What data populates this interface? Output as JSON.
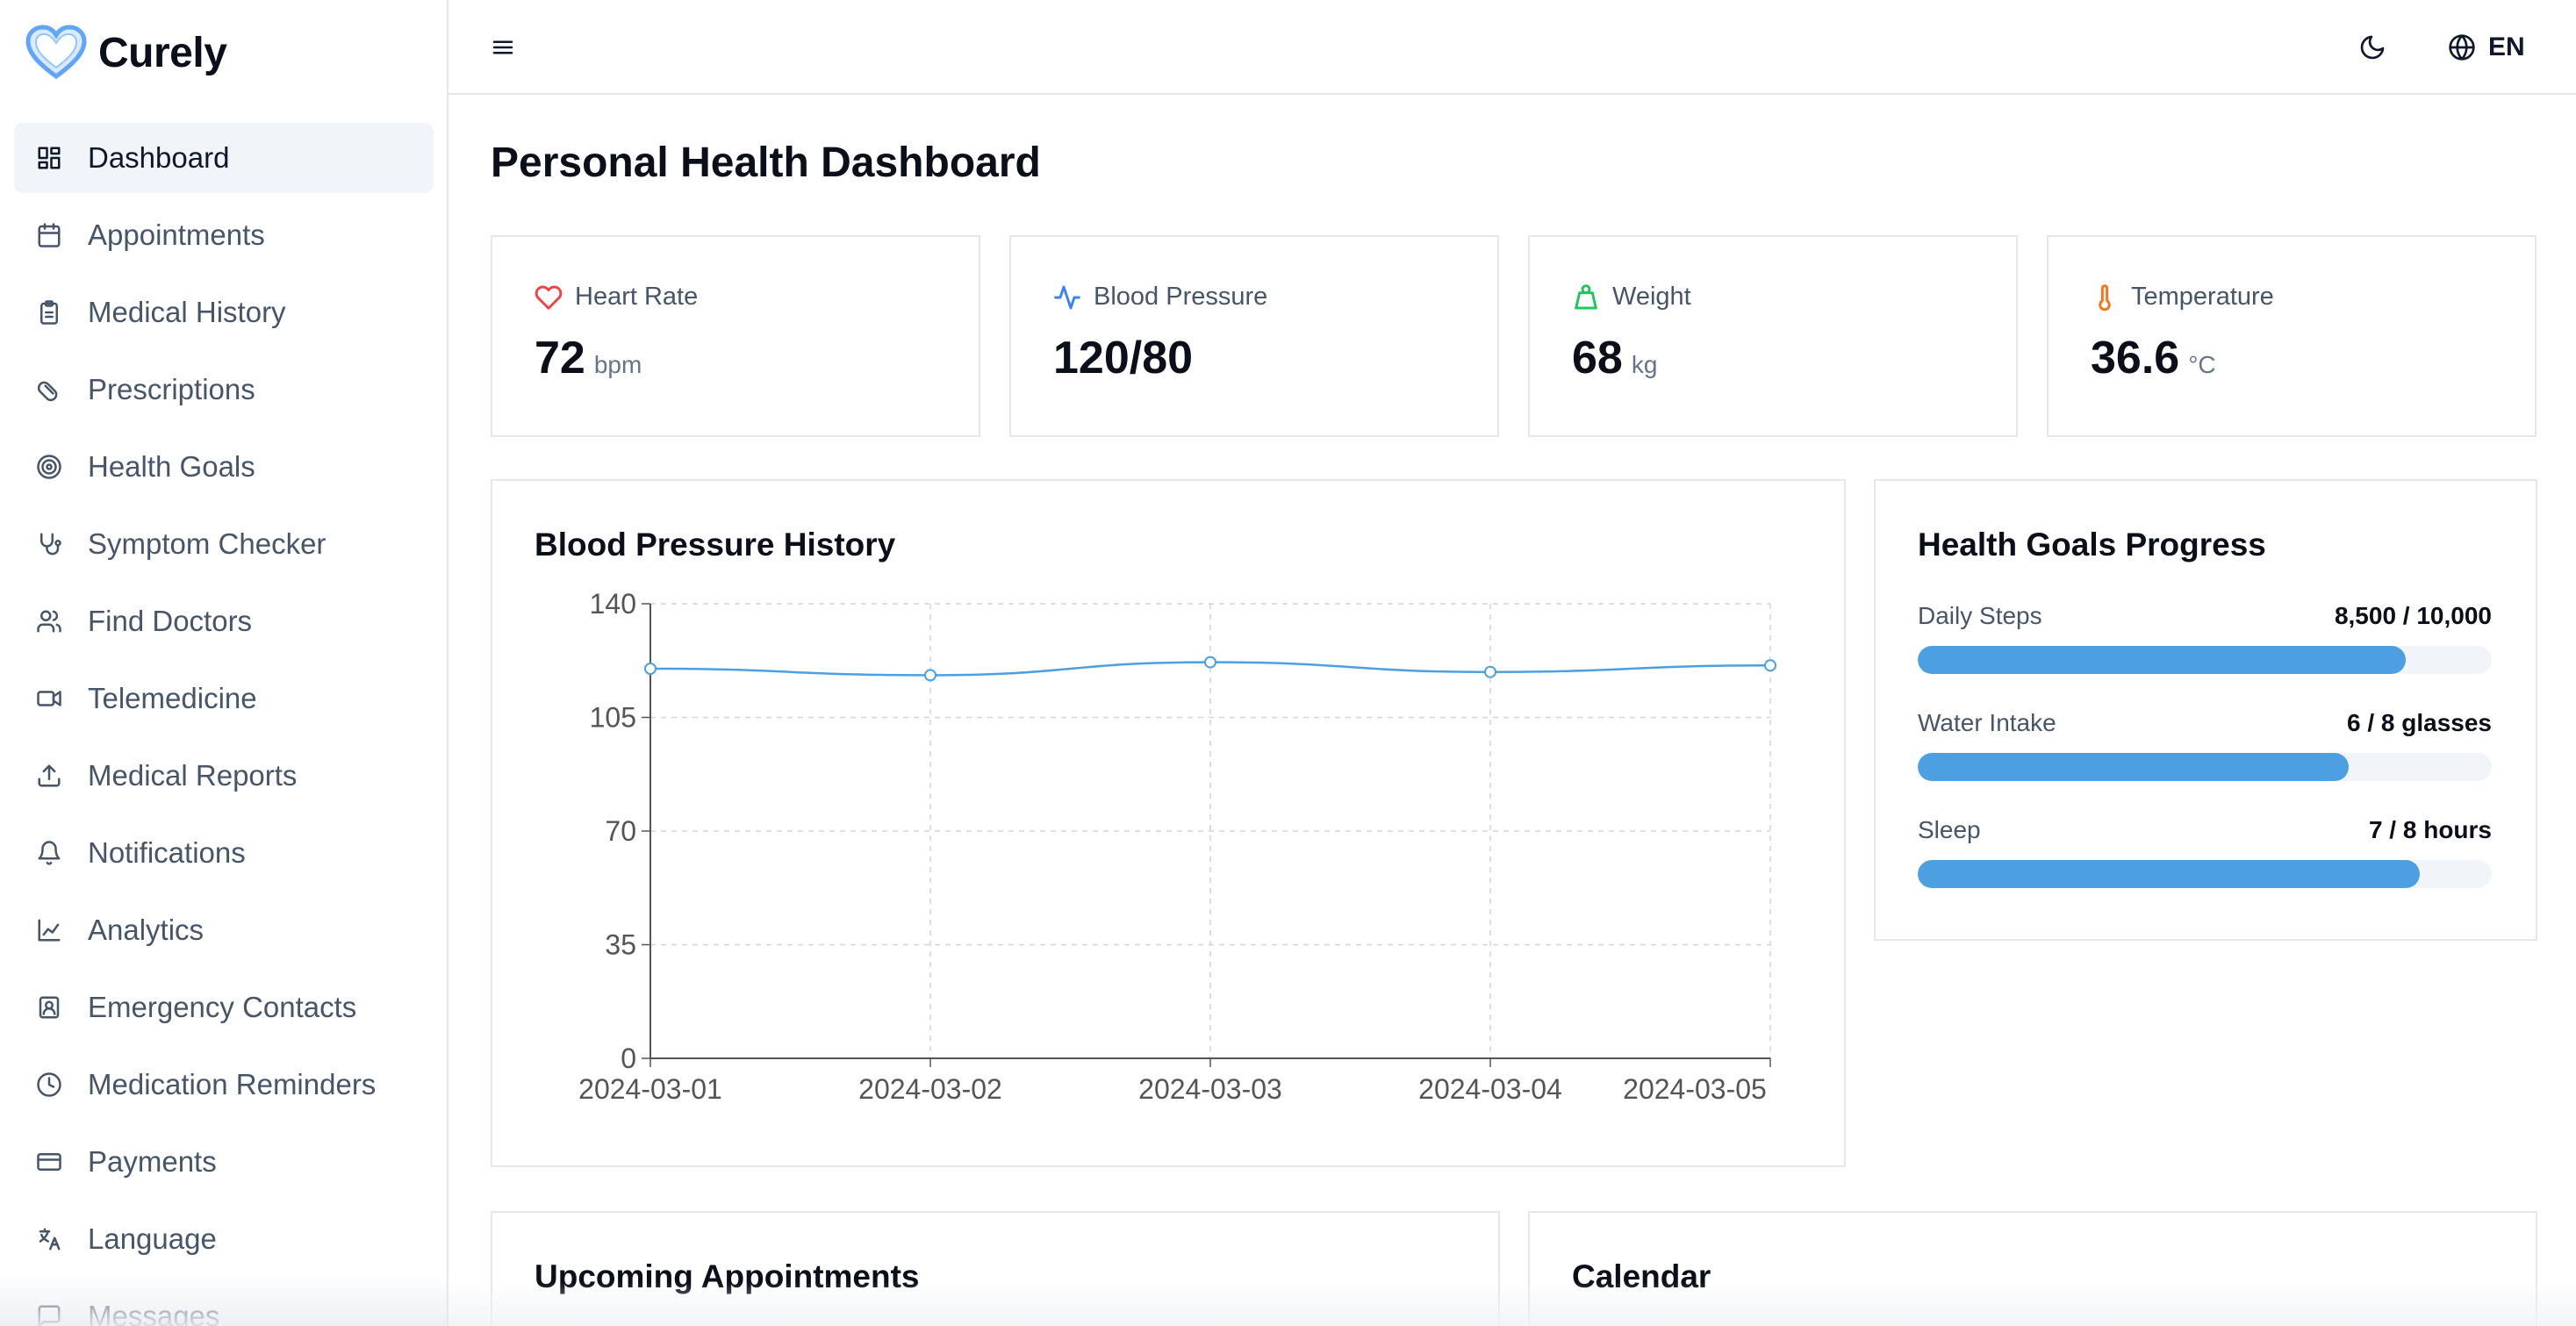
{
  "app": {
    "brand": "Curely"
  },
  "sidebar": {
    "items": [
      {
        "label": "Dashboard",
        "icon": "dashboard-icon",
        "active": true
      },
      {
        "label": "Appointments",
        "icon": "calendar-icon"
      },
      {
        "label": "Medical History",
        "icon": "clipboard-icon"
      },
      {
        "label": "Prescriptions",
        "icon": "pill-icon"
      },
      {
        "label": "Health Goals",
        "icon": "target-icon"
      },
      {
        "label": "Symptom Checker",
        "icon": "stethoscope-icon"
      },
      {
        "label": "Find Doctors",
        "icon": "users-icon"
      },
      {
        "label": "Telemedicine",
        "icon": "video-icon"
      },
      {
        "label": "Medical Reports",
        "icon": "upload-icon"
      },
      {
        "label": "Notifications",
        "icon": "bell-icon"
      },
      {
        "label": "Analytics",
        "icon": "line-chart-icon"
      },
      {
        "label": "Emergency Contacts",
        "icon": "contact-icon"
      },
      {
        "label": "Medication Reminders",
        "icon": "clock-icon"
      },
      {
        "label": "Payments",
        "icon": "credit-card-icon"
      },
      {
        "label": "Language",
        "icon": "translate-icon"
      },
      {
        "label": "Messages",
        "icon": "message-icon"
      }
    ]
  },
  "header": {
    "language": "EN"
  },
  "main": {
    "title": "Personal Health Dashboard",
    "stats": [
      {
        "label": "Heart Rate",
        "value": "72",
        "unit": "bpm",
        "icon": "heart-icon",
        "color": "#ef4444"
      },
      {
        "label": "Blood Pressure",
        "value": "120/80",
        "unit": "",
        "icon": "activity-icon",
        "color": "#3b82f6"
      },
      {
        "label": "Weight",
        "value": "68",
        "unit": "kg",
        "icon": "weight-icon",
        "color": "#22c55e"
      },
      {
        "label": "Temperature",
        "value": "36.6",
        "unit": "°C",
        "icon": "thermometer-icon",
        "color": "#f97316"
      }
    ],
    "bp_card": {
      "title": "Blood Pressure History"
    },
    "goals_card": {
      "title": "Health Goals Progress",
      "goals": [
        {
          "name": "Daily Steps",
          "value": "8,500 / 10,000",
          "progress": 0.85
        },
        {
          "name": "Water Intake",
          "value": "6 / 8 glasses",
          "progress": 0.75
        },
        {
          "name": "Sleep",
          "value": "7 / 8 hours",
          "progress": 0.875
        }
      ]
    },
    "appointments_card": {
      "title": "Upcoming Appointments"
    },
    "calendar_card": {
      "title": "Calendar"
    }
  },
  "colors": {
    "accent": "#4c9fe0",
    "line": "#4c9fe0"
  },
  "chart_data": {
    "type": "line",
    "title": "Blood Pressure History",
    "x": [
      "2024-03-01",
      "2024-03-02",
      "2024-03-03",
      "2024-03-04",
      "2024-03-05"
    ],
    "series": [
      {
        "values": [
          120,
          118,
          122,
          119,
          121
        ]
      }
    ],
    "ylim": [
      0,
      140
    ],
    "yticks": [
      0,
      35,
      70,
      105,
      140
    ],
    "grid": true
  }
}
